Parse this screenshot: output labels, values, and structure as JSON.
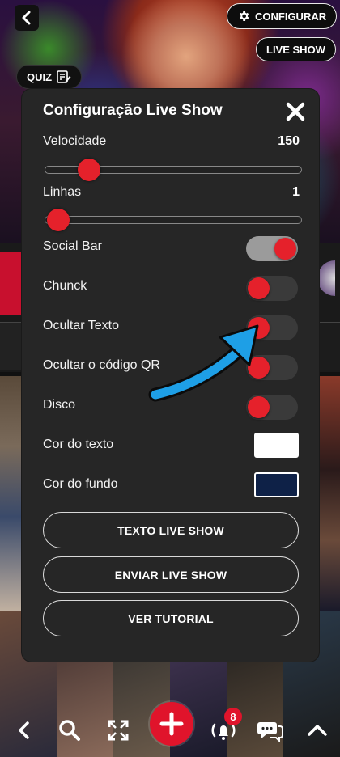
{
  "top_bar": {
    "configure_label": "CONFIGURAR",
    "live_show_label": "LIVE SHOW",
    "quiz_label": "QUIZ"
  },
  "modal": {
    "title": "Configuração Live Show",
    "speed": {
      "label": "Velocidade",
      "value": "150",
      "level": 0.17
    },
    "lines": {
      "label": "Linhas",
      "value": "1",
      "level": 0.05
    },
    "toggles": [
      {
        "label": "Social Bar",
        "on": true
      },
      {
        "label": "Chunck",
        "on": false
      },
      {
        "label": "Ocultar Texto",
        "on": false
      },
      {
        "label": "Ocultar o código QR",
        "on": false
      },
      {
        "label": "Disco",
        "on": false
      }
    ],
    "text_color": {
      "label": "Cor do texto",
      "color": "#ffffff"
    },
    "bg_color": {
      "label": "Cor do fundo",
      "color": "#0e2147"
    },
    "buttons": {
      "text_live_show": "TEXTO LIVE SHOW",
      "send_live_show": "ENVIAR LIVE SHOW",
      "tutorial": "VER TUTORIAL"
    }
  },
  "notifications_count": "8",
  "colors": {
    "accent_red": "#e5212b",
    "modal_bg": "#262626",
    "annotation_arrow": "#1e9fe6"
  },
  "icons": {
    "back": "chevron-left-icon",
    "configure": "gear-icon",
    "quiz": "edit-note-icon",
    "close": "close-icon",
    "nav": [
      "chevron-left-icon",
      "search-icon",
      "fullscreen-icon",
      "plus-icon",
      "live-bell-icon",
      "chat-icon",
      "chevron-up-icon"
    ]
  }
}
